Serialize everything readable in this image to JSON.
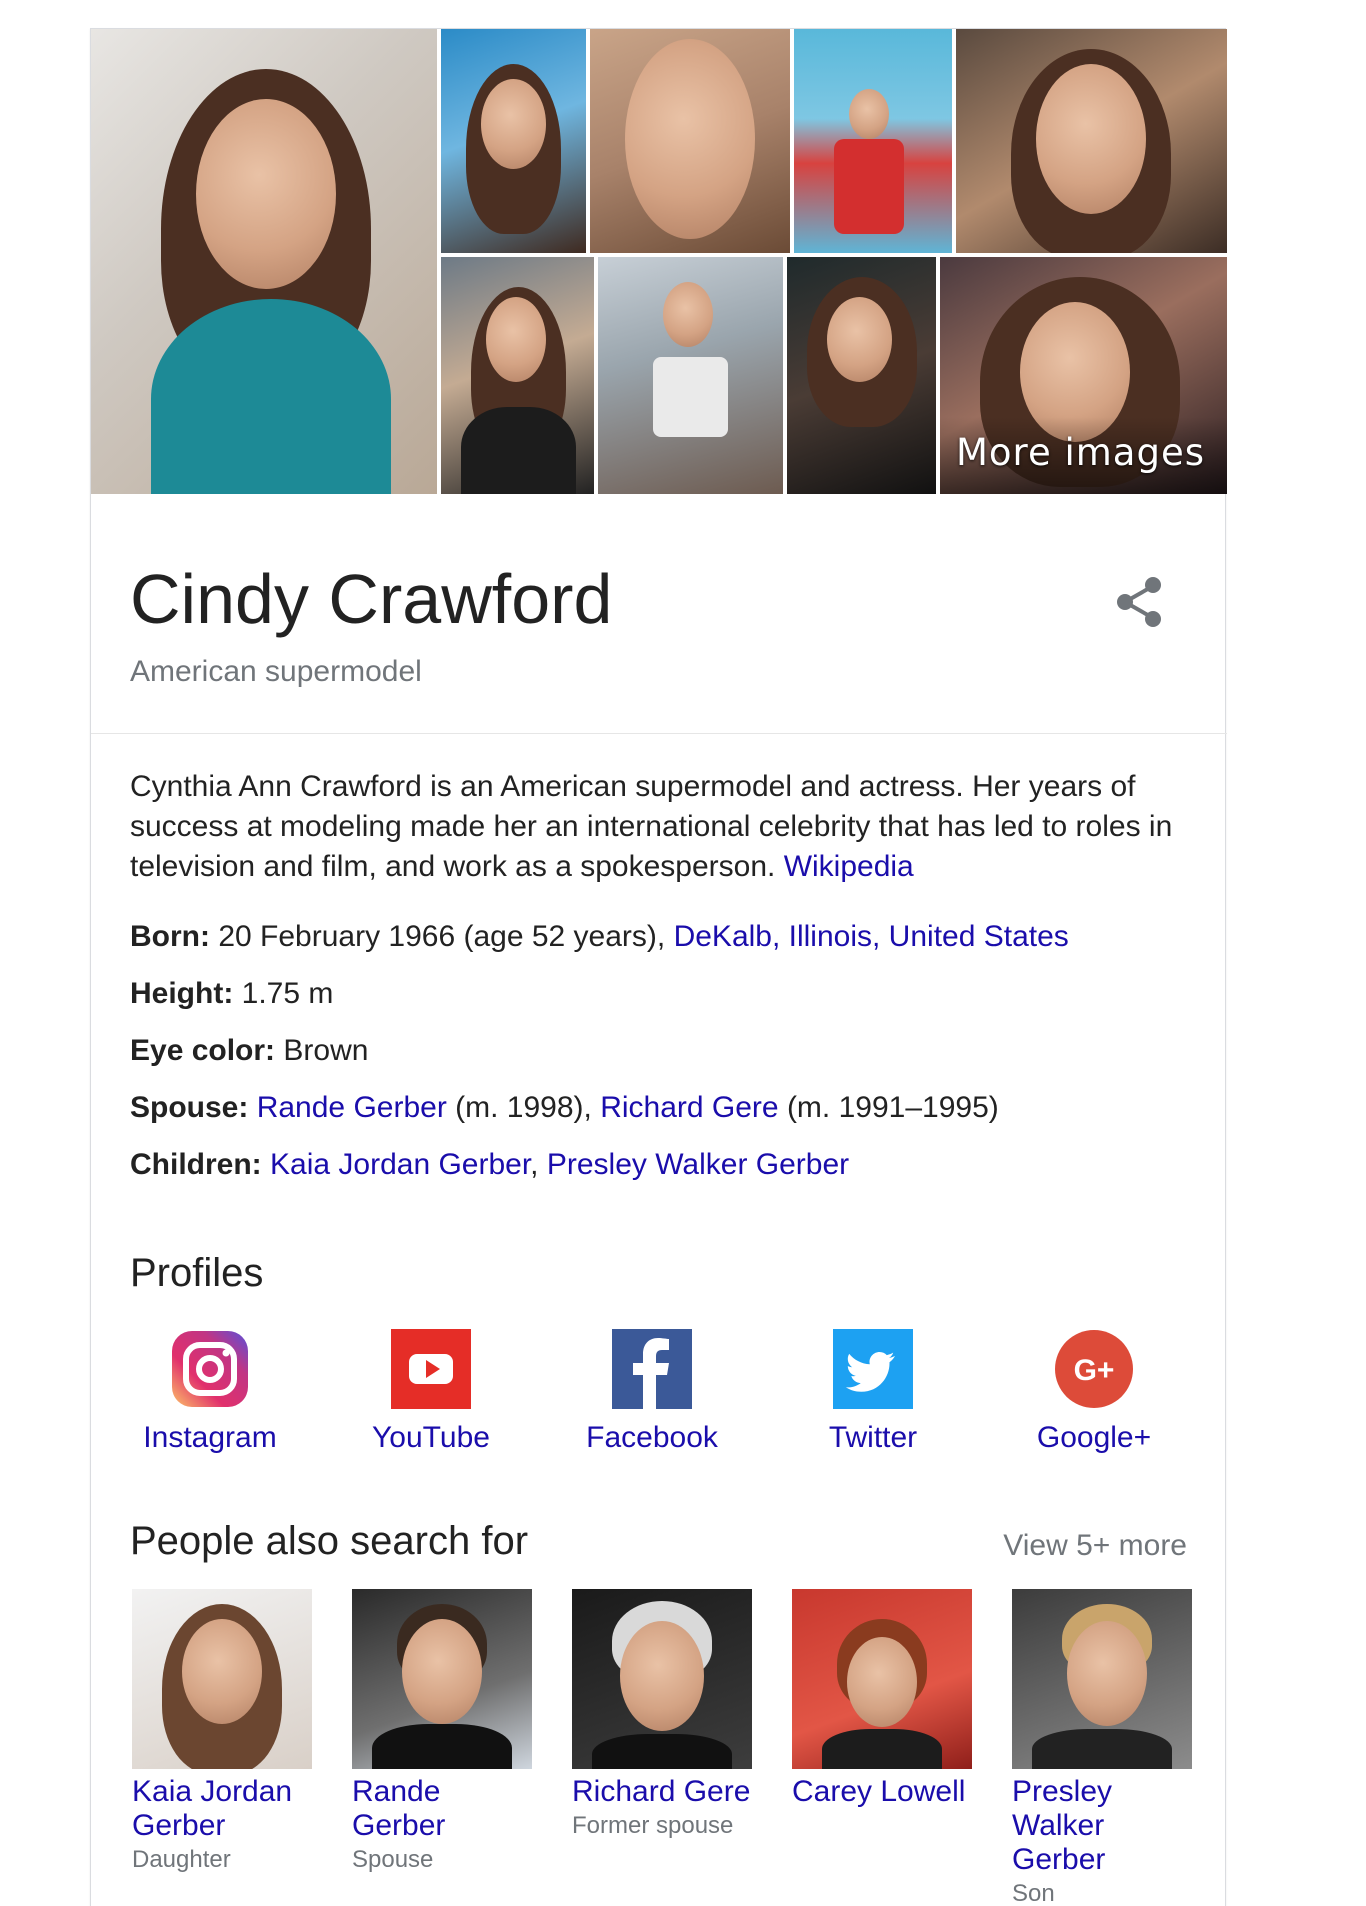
{
  "collage": {
    "more_images_label": "More images"
  },
  "header": {
    "title": "Cindy Crawford",
    "subtitle": "American supermodel"
  },
  "description": {
    "text": "Cynthia Ann Crawford is an American supermodel and actress. Her years of success at modeling made her an international celebrity that has led to roles in television and film, and work as a spokesperson.",
    "source_link": "Wikipedia"
  },
  "facts": {
    "born": {
      "label": "Born:",
      "value": " 20 February 1966 (age 52 years), ",
      "link": "DeKalb, Illinois, United States"
    },
    "height": {
      "label": "Height:",
      "value": " 1.75 m"
    },
    "eye_color": {
      "label": "Eye color:",
      "value": " Brown"
    },
    "spouse": {
      "label": "Spouse:",
      "link1": "Rande Gerber",
      "text1": " (m. 1998), ",
      "link2": "Richard Gere",
      "text2": " (m. 1991–1995)"
    },
    "children": {
      "label": "Children:",
      "link1": "Kaia Jordan Gerber",
      "sep": ", ",
      "link2": "Presley Walker Gerber"
    }
  },
  "profiles": {
    "heading": "Profiles",
    "items": [
      {
        "label": "Instagram",
        "icon": "instagram-icon"
      },
      {
        "label": "YouTube",
        "icon": "youtube-icon"
      },
      {
        "label": "Facebook",
        "icon": "facebook-icon"
      },
      {
        "label": "Twitter",
        "icon": "twitter-icon"
      },
      {
        "label": "Google+",
        "icon": "google-plus-icon",
        "glyph": "G+"
      }
    ]
  },
  "people_also_search": {
    "heading": "People also search for",
    "view_more": "View 5+ more",
    "items": [
      {
        "name": "Kaia Jordan Gerber",
        "role": "Daughter"
      },
      {
        "name": "Rande Gerber",
        "role": "Spouse"
      },
      {
        "name": "Richard Gere",
        "role": "Former spouse"
      },
      {
        "name": "Carey Lowell",
        "role": ""
      },
      {
        "name": "Presley Walker Gerber",
        "role": "Son"
      }
    ]
  },
  "colors": {
    "link": "#1a0dab",
    "muted": "#70757a",
    "text": "#222222",
    "youtube": "#e52d27",
    "facebook": "#3b5998",
    "twitter": "#1da1f2",
    "google_plus": "#dd4b39"
  }
}
